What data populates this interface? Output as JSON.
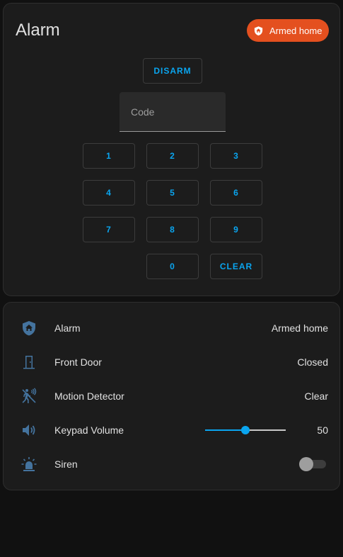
{
  "alarm_card": {
    "title": "Alarm",
    "state_badge": {
      "label": "Armed home",
      "color": "#e4501f",
      "icon": "shield-home-icon"
    },
    "disarm_label": "DISARM",
    "code_input": {
      "value": "",
      "placeholder": "Code"
    },
    "keypad": [
      "1",
      "2",
      "3",
      "4",
      "5",
      "6",
      "7",
      "8",
      "9",
      "0",
      "CLEAR"
    ]
  },
  "entities": [
    {
      "icon": "shield-home-icon",
      "name": "Alarm",
      "state": "Armed home"
    },
    {
      "icon": "door-closed-icon",
      "name": "Front Door",
      "state": "Closed"
    },
    {
      "icon": "motion-sensor-icon",
      "name": "Motion Detector",
      "state": "Clear"
    },
    {
      "icon": "volume-icon",
      "name": "Keypad Volume",
      "state": "50",
      "slider_value": 50,
      "slider_range": [
        0,
        100
      ]
    },
    {
      "icon": "siren-icon",
      "name": "Siren",
      "state": "off"
    }
  ],
  "colors": {
    "accent": "#0aa5ef",
    "icon": "#44739e",
    "armed_badge": "#e4501f"
  }
}
